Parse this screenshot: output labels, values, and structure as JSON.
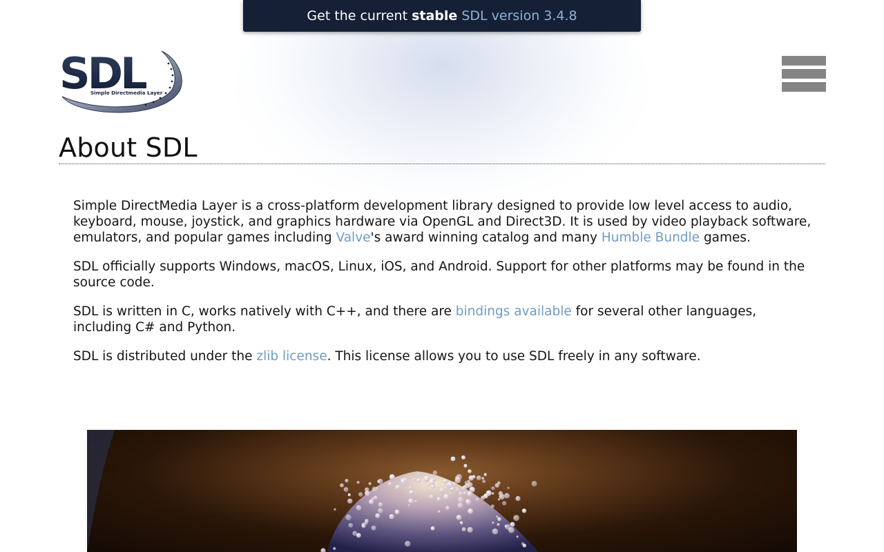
{
  "banner": {
    "prefix": "Get the current ",
    "stable": "stable",
    "version_link": "SDL version 3.4.8"
  },
  "logo": {
    "wordmark": "SDL",
    "tagline": "Simple Directmedia Layer"
  },
  "menu": {
    "icon": "hamburger-menu-icon"
  },
  "page": {
    "title": "About SDL"
  },
  "content": {
    "p1": {
      "text_a": "Simple DirectMedia Layer is a cross-platform development library designed to provide low level access to audio, keyboard, mouse, joystick, and graphics hardware via OpenGL and Direct3D. It is used by video playback software, emulators, and popular games including ",
      "link_valve": "Valve",
      "text_b": "'s award winning catalog and many ",
      "link_humble": "Humble Bundle",
      "text_c": " games."
    },
    "p2": {
      "text": "SDL officially supports Windows, macOS, Linux, iOS, and Android. Support for other platforms may be found in the source code."
    },
    "p3": {
      "text_a": "SDL is written in C, works natively with C++, and there are ",
      "link_bindings": "bindings available",
      "text_b": " for several other languages, including C# and Python."
    },
    "p4": {
      "text_a": "SDL is distributed under the ",
      "link_zlib": "zlib license",
      "text_b": ". This license allows you to use SDL freely in any software."
    }
  },
  "colors": {
    "banner_bg": "#152036",
    "link": "#6f9bc4",
    "banner_link": "#8fb3d9",
    "menu_bars": "#858585"
  }
}
